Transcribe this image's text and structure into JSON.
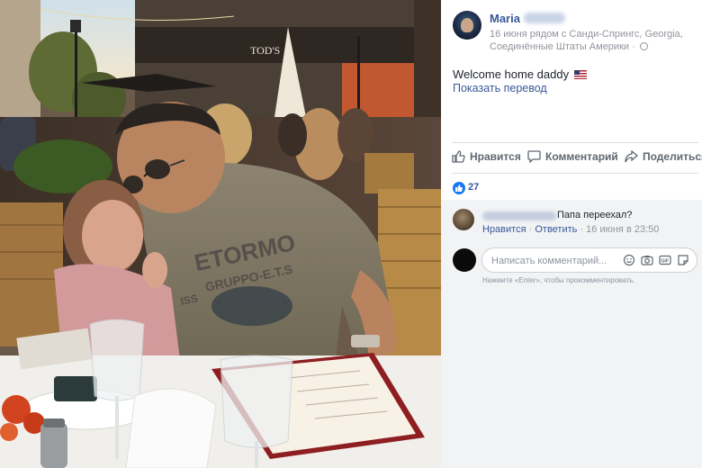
{
  "post": {
    "author": "Maria",
    "meta": "16 июня рядом с Санди-Спрингс, Georgia, Соединённые Штаты Америки · ",
    "text": "Welcome home daddy",
    "translate_link": "Показать перевод"
  },
  "actions": {
    "like": "Нравится",
    "comment": "Комментарий",
    "share": "Поделиться"
  },
  "reactions": {
    "count": "27"
  },
  "comment": {
    "text": "Папа переехал?",
    "like": "Нравится",
    "reply": "Ответить",
    "time": "16 июня в 23:50"
  },
  "composer": {
    "placeholder": "Написать комментарий...",
    "hint": "Нажмите «Enter», чтобы прокомментировать."
  },
  "photo": {
    "shirt_print_line1": "ETORMO",
    "shirt_print_line2": "GRUPPO-E.T.S",
    "shirt_print_line3": "ISS"
  },
  "colors": {
    "link": "#385898",
    "meta_gray": "#90949c",
    "like_blue": "#1877f2",
    "comment_bg": "#f2f3f5"
  },
  "icons": [
    "globe-icon",
    "us-flag-icon",
    "thumbs-up-icon",
    "comment-icon",
    "share-icon",
    "like-badge-icon",
    "emoji-icon",
    "camera-icon",
    "gif-icon",
    "sticker-icon"
  ]
}
